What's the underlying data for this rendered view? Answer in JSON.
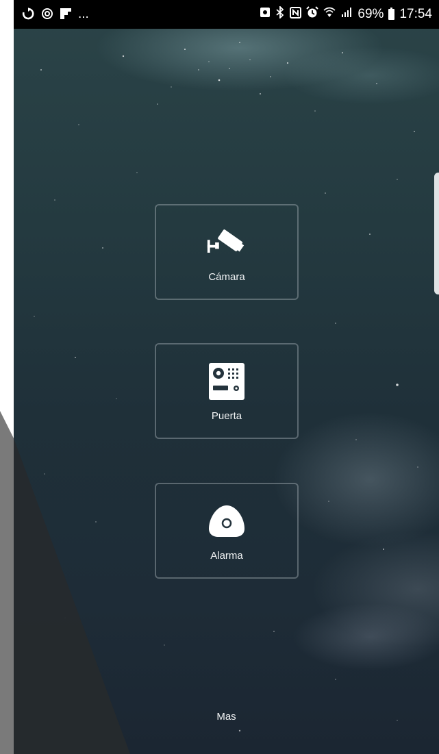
{
  "status_bar": {
    "left_icons": [
      "sync-icon",
      "data-saver-icon",
      "flipboard-icon"
    ],
    "overflow": "...",
    "right_icons": [
      "photo-icon",
      "bluetooth-icon",
      "nfc-icon",
      "alarm-icon",
      "wifi-icon",
      "signal-icon"
    ],
    "battery": "69%",
    "time": "17:54"
  },
  "tiles": [
    {
      "label": "Cámara",
      "icon": "security-camera-icon"
    },
    {
      "label": "Puerta",
      "icon": "door-intercom-icon"
    },
    {
      "label": "Alarma",
      "icon": "alarm-sensor-icon"
    }
  ],
  "footer": {
    "more_label": "Mas"
  }
}
